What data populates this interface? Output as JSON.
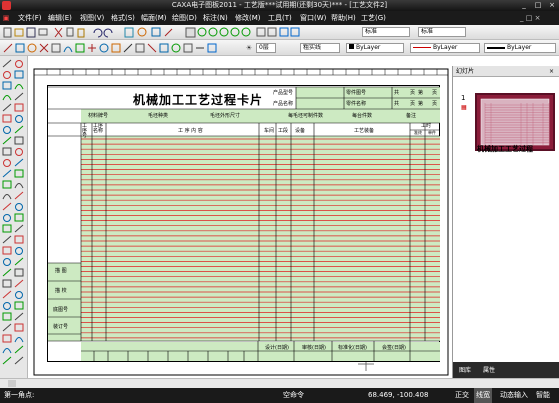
{
  "window": {
    "title": "CAXA电子图板2011 - 工艺版***试用期(还剩30天)*** - [工艺文件2]",
    "controls": [
      "_",
      "□",
      "×"
    ]
  },
  "menu": [
    "文件(F)",
    "编辑(E)",
    "视图(V)",
    "格式(S)",
    "幅面(M)",
    "绘图(D)",
    "标注(N)",
    "修改(M)",
    "工具(T)",
    "窗口(W)",
    "帮助(H)",
    "工艺(G)"
  ],
  "toolbar": {
    "style_combo_1": "标准",
    "style_combo_2": "标准",
    "layer_combo": "0层",
    "linetype_combo": "粗实线",
    "color_combo": "ByLayer",
    "linetype2_combo": "ByLayer",
    "lineweight_combo": "ByLayer"
  },
  "card": {
    "title": "机械加工工艺过程卡片",
    "product_model_label": "产品型号",
    "product_name_label": "产品名称",
    "part_drawing_label": "零件图号",
    "part_name_label": "零件名称",
    "total_pages_label": "共",
    "page_label": "第",
    "page_unit": "页",
    "material_label": "材料牌号",
    "blank_type_label": "毛坯种类",
    "blank_size_label": "毛坯外形尺寸",
    "per_blank_label": "每毛坯可制件数",
    "per_unit_label": "每台件数",
    "remarks_label": "备注",
    "col_seq_label": "工序号",
    "col_name_label": "工序名称",
    "col_content_label": "工 序 内 容",
    "col_workshop_label": "车间",
    "col_section_label": "工段",
    "col_equipment_label": "设备",
    "col_tooling_label": "工艺装备",
    "col_time_label": "工时",
    "col_time_quasi": "准终",
    "col_time_unit": "单件",
    "left_labels": [
      "描 图",
      "描 校",
      "底图号",
      "装订号"
    ],
    "sign_labels": [
      "设计(日期)",
      "审核(日期)",
      "标准化(日期)",
      "会签(日期)"
    ]
  },
  "panel": {
    "title": "幻灯片",
    "slide_number": "1",
    "slide_caption": "机械加工工艺过程",
    "tabs": [
      "图库",
      "属性"
    ]
  },
  "status": {
    "prompt": "第一角点:",
    "command": "空命令",
    "coords": "68.469, -100.408",
    "buttons": [
      "正交",
      "线宽",
      "动态输入",
      "智能"
    ]
  }
}
